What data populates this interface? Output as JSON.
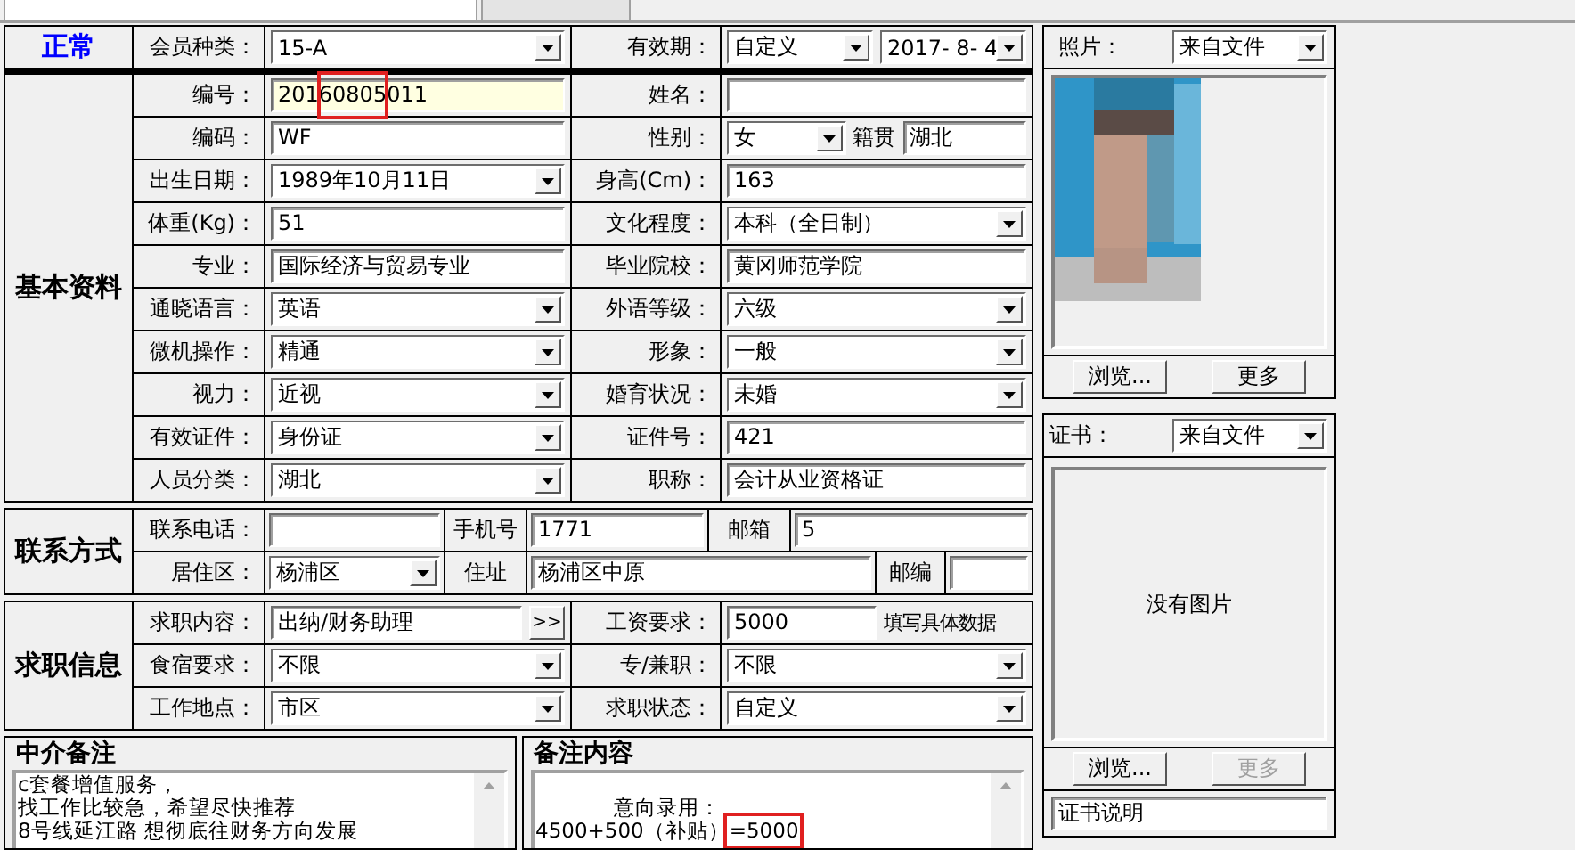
{
  "tabs": [
    {
      "selected": true
    },
    {
      "selected": false
    }
  ],
  "status": {
    "label": "正常",
    "slots": [
      {
        "label": "会员种类：",
        "controls": [
          {
            "kind": "combo",
            "value": "15-A"
          }
        ]
      },
      {
        "label": "有效期：",
        "controls": [
          {
            "kind": "combo",
            "value": "自定义"
          },
          {
            "kind": "combo",
            "value": "2017- 8- 4"
          }
        ]
      }
    ]
  },
  "basic": {
    "title": "基本资料",
    "rows": [
      [
        {
          "label": "编号：",
          "controls": [
            {
              "kind": "text",
              "value": "20160805011",
              "focused": true,
              "highlighted": true
            }
          ]
        },
        {
          "label": "姓名：",
          "controls": [
            {
              "kind": "text"
            }
          ]
        }
      ],
      [
        {
          "label": "编码：",
          "controls": [
            {
              "kind": "text",
              "value": "WF"
            }
          ]
        },
        {
          "label": "性别：",
          "controls": [
            {
              "kind": "combo",
              "value": "女"
            },
            {
              "kind": "note",
              "value": "籍贯"
            },
            {
              "kind": "text",
              "value": "湖北"
            }
          ]
        }
      ],
      [
        {
          "label": "出生日期：",
          "controls": [
            {
              "kind": "combo",
              "value": "1989年10月11日"
            }
          ]
        },
        {
          "label": "身高(Cm)：",
          "controls": [
            {
              "kind": "text",
              "value": "163"
            }
          ]
        }
      ],
      [
        {
          "label": "体重(Kg)：",
          "controls": [
            {
              "kind": "text",
              "value": "51"
            }
          ]
        },
        {
          "label": "文化程度：",
          "controls": [
            {
              "kind": "combo",
              "value": "本科（全日制）"
            }
          ]
        }
      ],
      [
        {
          "label": "专业：",
          "controls": [
            {
              "kind": "text",
              "value": "国际经济与贸易专业"
            }
          ]
        },
        {
          "label": "毕业院校：",
          "controls": [
            {
              "kind": "text",
              "value": "黄冈师范学院"
            }
          ]
        }
      ],
      [
        {
          "label": "通晓语言：",
          "controls": [
            {
              "kind": "combo",
              "value": "英语"
            }
          ]
        },
        {
          "label": "外语等级：",
          "controls": [
            {
              "kind": "combo",
              "value": "六级"
            }
          ]
        }
      ],
      [
        {
          "label": "微机操作：",
          "controls": [
            {
              "kind": "combo",
              "value": "精通"
            }
          ]
        },
        {
          "label": "形象：",
          "controls": [
            {
              "kind": "combo",
              "value": "一般"
            }
          ]
        }
      ],
      [
        {
          "label": "视力：",
          "controls": [
            {
              "kind": "combo",
              "value": "近视"
            }
          ]
        },
        {
          "label": "婚育状况：",
          "controls": [
            {
              "kind": "combo",
              "value": "未婚"
            }
          ]
        }
      ],
      [
        {
          "label": "有效证件：",
          "controls": [
            {
              "kind": "combo",
              "value": "身份证"
            }
          ]
        },
        {
          "label": "证件号：",
          "controls": [
            {
              "kind": "text",
              "value": "421"
            }
          ]
        }
      ],
      [
        {
          "label": "人员分类：",
          "controls": [
            {
              "kind": "combo",
              "value": "湖北"
            }
          ]
        },
        {
          "label": "职称：",
          "controls": [
            {
              "kind": "text",
              "value": "会计从业资格证"
            }
          ]
        }
      ]
    ]
  },
  "contact": {
    "title": "联系方式",
    "rows": [
      [
        {
          "label": "联系电话：",
          "controls": [
            {
              "kind": "text"
            }
          ]
        },
        {
          "label": "手机号",
          "controls": [
            {
              "kind": "text",
              "value": "1771"
            }
          ]
        },
        {
          "label": "邮箱",
          "controls": [
            {
              "kind": "text",
              "value": "5"
            }
          ]
        }
      ],
      [
        {
          "label": "居住区：",
          "controls": [
            {
              "kind": "combo",
              "value": "杨浦区"
            }
          ]
        },
        {
          "label": "住址",
          "controls": [
            {
              "kind": "text",
              "value": "杨浦区中原"
            }
          ]
        },
        {
          "label": "邮编",
          "controls": [
            {
              "kind": "text"
            }
          ]
        }
      ]
    ]
  },
  "job": {
    "title": "求职信息",
    "rows": [
      [
        {
          "label": "求职内容：",
          "controls": [
            {
              "kind": "text",
              "value": "出纳/财务助理"
            },
            {
              "kind": "button",
              "value": ">>"
            }
          ]
        },
        {
          "label": "工资要求：",
          "controls": [
            {
              "kind": "text",
              "value": "5000"
            },
            {
              "kind": "note",
              "value": "填写具体数据"
            }
          ]
        }
      ],
      [
        {
          "label": "食宿要求：",
          "controls": [
            {
              "kind": "combo",
              "value": "不限"
            }
          ]
        },
        {
          "label": "专/兼职：",
          "controls": [
            {
              "kind": "combo",
              "value": "不限"
            }
          ]
        }
      ],
      [
        {
          "label": "工作地点：",
          "controls": [
            {
              "kind": "combo",
              "value": "市区"
            }
          ]
        },
        {
          "label": "求职状态：",
          "controls": [
            {
              "kind": "combo",
              "value": "自定义"
            }
          ]
        }
      ]
    ]
  },
  "notes": [
    {
      "title": "中介备注",
      "lines": [
        "c套餐增值服务，",
        "找工作比较急，希望尽快推荐",
        "8号线延江路 想彻底往财务方向发展"
      ],
      "highlighted": false
    },
    {
      "title": "备注内容",
      "lines": [
        "意向录用：",
        "4500+500（补贴）=5000"
      ],
      "highlighted": true
    }
  ],
  "photo": {
    "label": "照片：",
    "source": "来自文件",
    "buttons": [
      {
        "label": "浏览...",
        "disabled": false
      },
      {
        "label": "更多",
        "disabled": false
      }
    ]
  },
  "certificate": {
    "label": "证书：",
    "source": "来自文件",
    "empty_text": "没有图片",
    "buttons": [
      {
        "label": "浏览...",
        "disabled": false
      },
      {
        "label": "更多",
        "disabled": true
      }
    ],
    "caption": "证书说明"
  }
}
